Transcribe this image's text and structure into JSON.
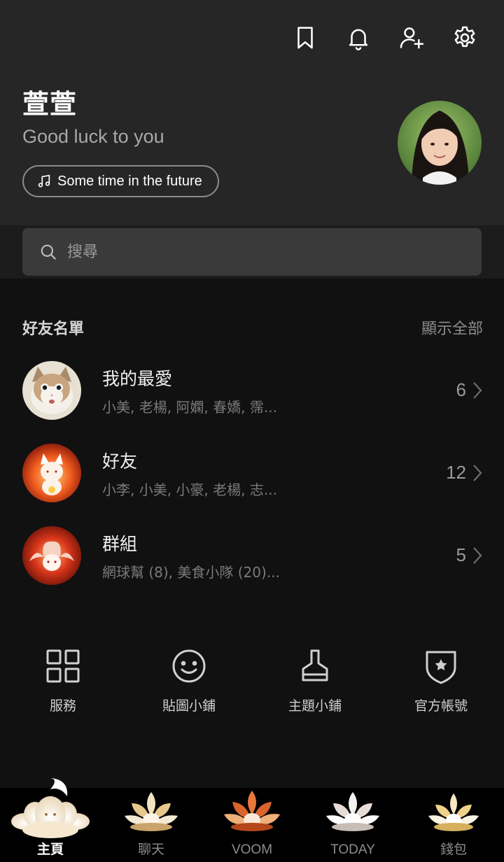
{
  "profile": {
    "name": "萱萱",
    "status_message": "Good luck to you",
    "music": "Some time in the future"
  },
  "search": {
    "placeholder": "搜尋"
  },
  "friends": {
    "section_title": "好友名單",
    "show_all": "顯示全部",
    "groups": [
      {
        "title": "我的最愛",
        "members": "小美, 老楊, 阿嫻, 春嬌, 霈...",
        "count": "6"
      },
      {
        "title": "好友",
        "members": "小李, 小美, 小豪, 老楊, 志...",
        "count": "12"
      },
      {
        "title": "群組",
        "members": "網球幫 (8), 美食小隊 (20)...",
        "count": "5"
      }
    ]
  },
  "services": [
    {
      "label": "服務",
      "icon": "grid-icon"
    },
    {
      "label": "貼圖小鋪",
      "icon": "smiley-icon"
    },
    {
      "label": "主題小鋪",
      "icon": "brush-icon"
    },
    {
      "label": "官方帳號",
      "icon": "shield-star-icon"
    }
  ],
  "tabs": [
    {
      "label": "主頁",
      "active": true
    },
    {
      "label": "聊天",
      "active": false
    },
    {
      "label": "VOOM",
      "active": false
    },
    {
      "label": "TODAY",
      "active": false
    },
    {
      "label": "錢包",
      "active": false
    }
  ],
  "colors": {
    "background": "#111111",
    "header": "#262626",
    "search_field": "#3a3a3a",
    "tabbar": "#000000"
  }
}
